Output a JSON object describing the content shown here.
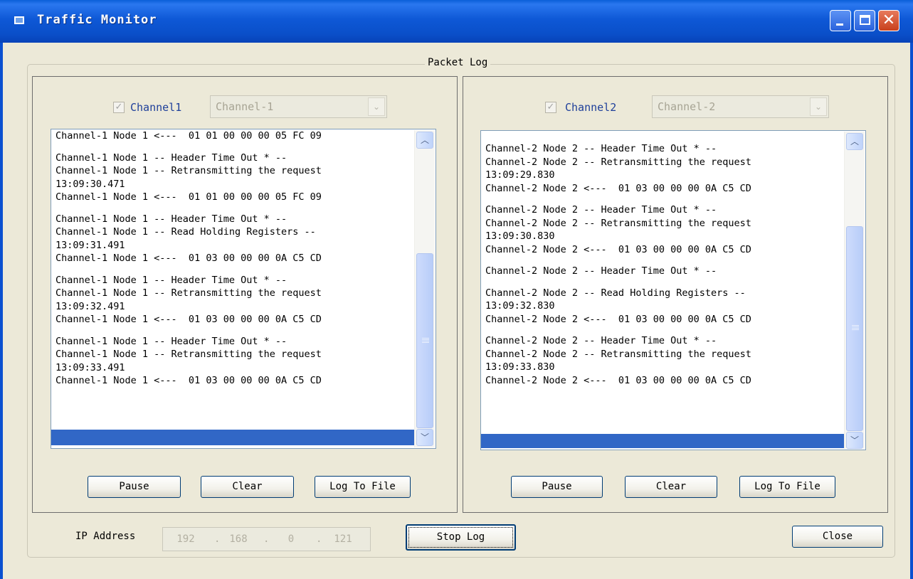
{
  "window": {
    "title": "Traffic Monitor"
  },
  "group": {
    "title": "Packet Log"
  },
  "channels": [
    {
      "checkbox_label": "Channel1",
      "selected_channel": "Channel-1",
      "log_lines": [
        "Channel-1 Node 1 <---  01 01 00 00 00 05 FC 09",
        "",
        "Channel-1 Node 1 -- Header Time Out * --",
        "Channel-1 Node 1 -- Retransmitting the request",
        "13:09:30.471",
        "Channel-1 Node 1 <---  01 01 00 00 00 05 FC 09",
        "",
        "Channel-1 Node 1 -- Header Time Out * --",
        "Channel-1 Node 1 -- Read Holding Registers --",
        "13:09:31.491",
        "Channel-1 Node 1 <---  01 03 00 00 00 0A C5 CD",
        "",
        "Channel-1 Node 1 -- Header Time Out * --",
        "Channel-1 Node 1 -- Retransmitting the request",
        "13:09:32.491",
        "Channel-1 Node 1 <---  01 03 00 00 00 0A C5 CD",
        "",
        "Channel-1 Node 1 -- Header Time Out * --",
        "Channel-1 Node 1 -- Retransmitting the request",
        "13:09:33.491",
        "Channel-1 Node 1 <---  01 03 00 00 00 0A C5 CD"
      ],
      "buttons": {
        "pause": "Pause",
        "clear": "Clear",
        "log_to_file": "Log To File"
      }
    },
    {
      "checkbox_label": "Channel2",
      "selected_channel": "Channel-2",
      "log_lines": [
        "",
        "Channel-2 Node 2 -- Header Time Out * --",
        "Channel-2 Node 2 -- Retransmitting the request",
        "13:09:29.830",
        "Channel-2 Node 2 <---  01 03 00 00 00 0A C5 CD",
        "",
        "Channel-2 Node 2 -- Header Time Out * --",
        "Channel-2 Node 2 -- Retransmitting the request",
        "13:09:30.830",
        "Channel-2 Node 2 <---  01 03 00 00 00 0A C5 CD",
        "",
        "Channel-2 Node 2 -- Header Time Out * --",
        "",
        "Channel-2 Node 2 -- Read Holding Registers --",
        "13:09:32.830",
        "Channel-2 Node 2 <---  01 03 00 00 00 0A C5 CD",
        "",
        "Channel-2 Node 2 -- Header Time Out * --",
        "Channel-2 Node 2 -- Retransmitting the request",
        "13:09:33.830",
        "Channel-2 Node 2 <---  01 03 00 00 00 0A C5 CD"
      ],
      "buttons": {
        "pause": "Pause",
        "clear": "Clear",
        "log_to_file": "Log To File"
      }
    }
  ],
  "footer": {
    "ip_label": "IP Address",
    "ip_segments": [
      "192",
      "168",
      "0",
      "121"
    ],
    "stop_log": "Stop Log",
    "close": "Close"
  },
  "colors": {
    "title_bar": "#0a50d0",
    "selection": "#3167c6",
    "background": "#ece9d8"
  },
  "icons": [
    "app-icon",
    "minimize-icon",
    "maximize-icon",
    "close-icon",
    "checkmark-icon",
    "dropdown-arrow-icon",
    "scroll-up-icon",
    "scroll-down-icon"
  ]
}
